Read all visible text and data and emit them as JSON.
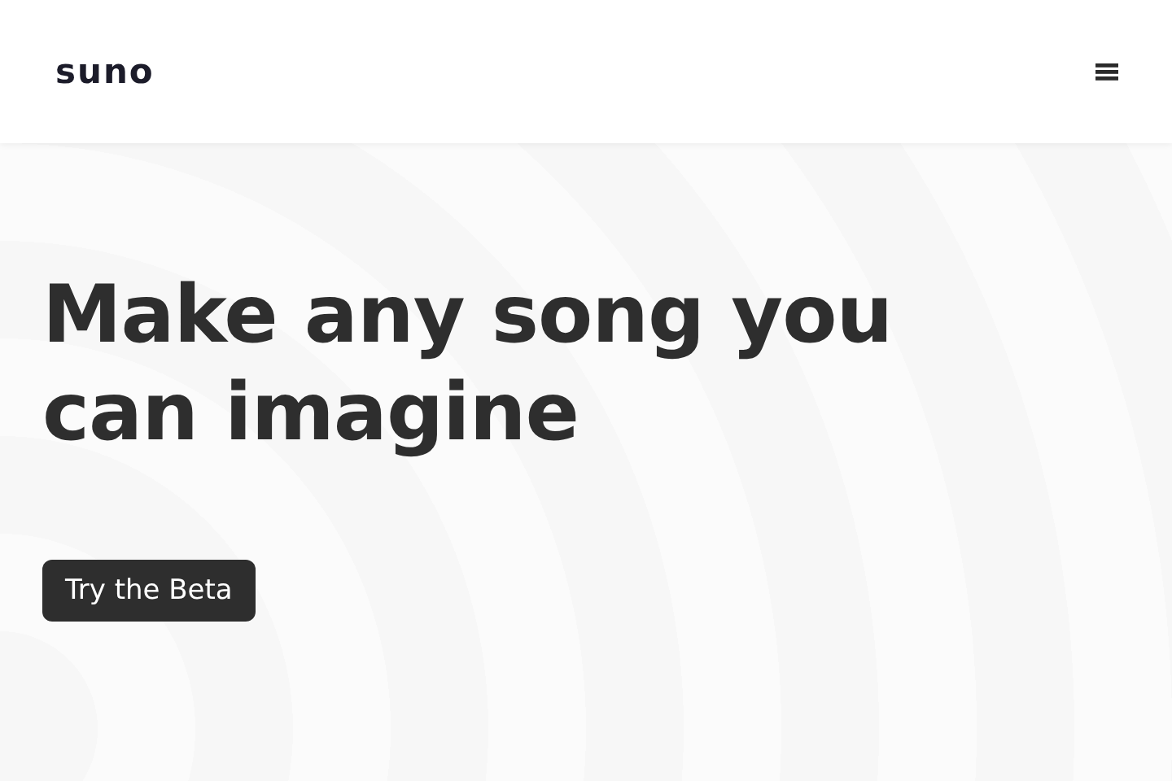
{
  "header": {
    "logo": "suno"
  },
  "hero": {
    "title": "Make any song you can imagine",
    "button": "Try the Beta"
  }
}
